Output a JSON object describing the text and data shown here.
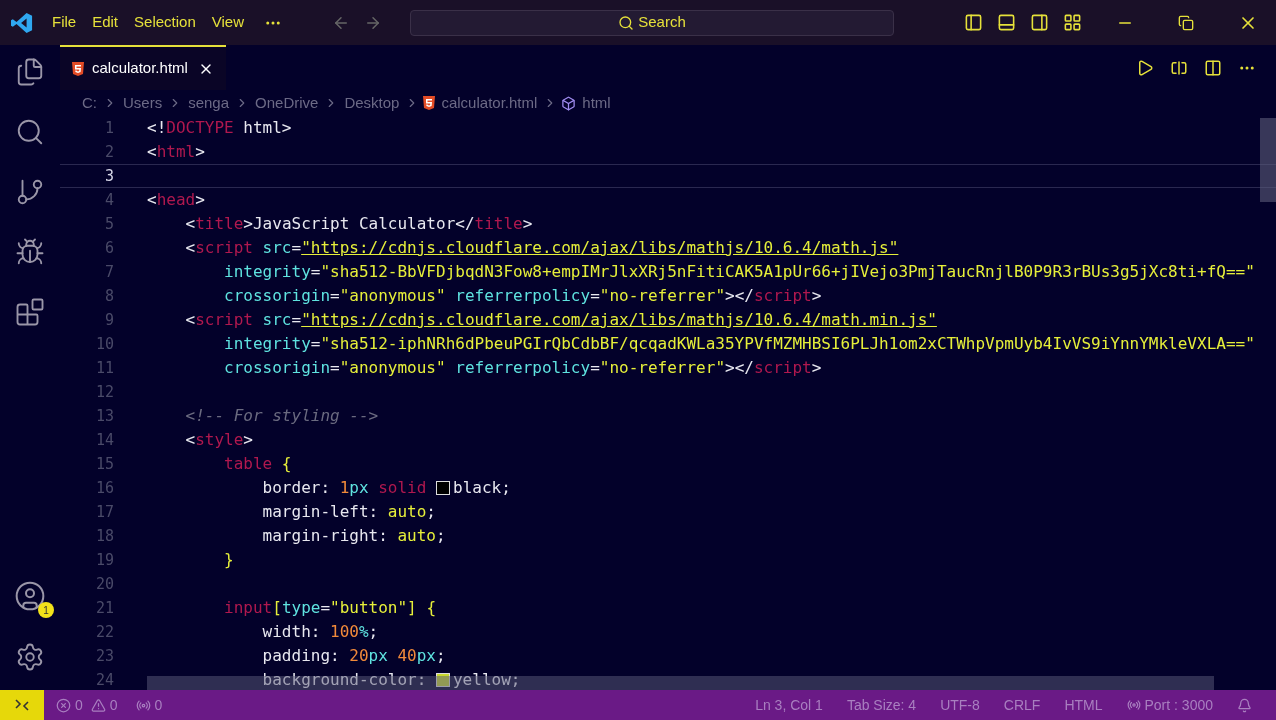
{
  "menu": [
    "File",
    "Edit",
    "Selection",
    "View"
  ],
  "search": {
    "placeholder": "Search"
  },
  "tabs": [
    {
      "label": "calculator.html",
      "selected": true
    }
  ],
  "breadcrumbs": [
    {
      "kind": "folder",
      "text": "C:"
    },
    {
      "kind": "folder",
      "text": "Users"
    },
    {
      "kind": "folder",
      "text": "senga"
    },
    {
      "kind": "folder",
      "text": "OneDrive"
    },
    {
      "kind": "folder",
      "text": "Desktop"
    },
    {
      "kind": "file",
      "text": "calculator.html"
    },
    {
      "kind": "element",
      "text": "html"
    }
  ],
  "account_badge": "1",
  "lines": [
    {
      "number": "1",
      "selected": false,
      "tokens": [
        {
          "kind": "p",
          "text": "<!"
        },
        {
          "kind": "tag",
          "text": "DOCTYPE"
        },
        {
          "kind": "p",
          "text": " html>"
        }
      ]
    },
    {
      "number": "2",
      "selected": false,
      "tokens": [
        {
          "kind": "p",
          "text": "<"
        },
        {
          "kind": "tag",
          "text": "html"
        },
        {
          "kind": "p",
          "text": ">"
        }
      ]
    },
    {
      "number": "3",
      "selected": true
    },
    {
      "number": "4",
      "selected": false,
      "tokens": [
        {
          "kind": "p",
          "text": "<"
        },
        {
          "kind": "tag",
          "text": "head"
        },
        {
          "kind": "p",
          "text": ">"
        }
      ]
    },
    {
      "number": "5",
      "selected": false,
      "tokens": [
        {
          "kind": "p",
          "text": "    <"
        },
        {
          "kind": "tag",
          "text": "title"
        },
        {
          "kind": "p",
          "text": ">JavaScript Calculator</"
        },
        {
          "kind": "tag",
          "text": "title"
        },
        {
          "kind": "p",
          "text": ">"
        }
      ]
    },
    {
      "number": "6",
      "selected": false,
      "tokens": [
        {
          "kind": "p",
          "text": "    <"
        },
        {
          "kind": "tag",
          "text": "script"
        },
        {
          "kind": "attr",
          "text": " src"
        },
        {
          "kind": "p",
          "text": "="
        },
        {
          "kind": "url",
          "text": "\"https://cdnjs.cloudflare.com/ajax/libs/mathjs/10.6.4/math.js\""
        }
      ]
    },
    {
      "number": "7",
      "selected": false,
      "tokens": [
        {
          "kind": "attr",
          "text": "        integrity"
        },
        {
          "kind": "p",
          "text": "="
        },
        {
          "kind": "str",
          "text": "\"sha512-BbVFDjbqdN3Fow8+empIMrJlxXRj5nFitiCAK5A1pUr66+jIVejo3PmjTaucRnjlB0P9R3rBUs3g5jXc8ti+fQ==\""
        }
      ]
    },
    {
      "number": "8",
      "selected": false,
      "tokens": [
        {
          "kind": "attr",
          "text": "        crossorigin"
        },
        {
          "kind": "p",
          "text": "="
        },
        {
          "kind": "str",
          "text": "\"anonymous\""
        },
        {
          "kind": "attr",
          "text": " referrerpolicy"
        },
        {
          "kind": "p",
          "text": "="
        },
        {
          "kind": "str",
          "text": "\"no-referrer\""
        },
        {
          "kind": "p",
          "text": "></"
        },
        {
          "kind": "tag",
          "text": "script"
        },
        {
          "kind": "p",
          "text": ">"
        }
      ]
    },
    {
      "number": "9",
      "selected": false,
      "tokens": [
        {
          "kind": "p",
          "text": "    <"
        },
        {
          "kind": "tag",
          "text": "script"
        },
        {
          "kind": "attr",
          "text": " src"
        },
        {
          "kind": "p",
          "text": "="
        },
        {
          "kind": "url",
          "text": "\"https://cdnjs.cloudflare.com/ajax/libs/mathjs/10.6.4/math.min.js\""
        }
      ]
    },
    {
      "number": "10",
      "selected": false,
      "tokens": [
        {
          "kind": "attr",
          "text": "        integrity"
        },
        {
          "kind": "p",
          "text": "="
        },
        {
          "kind": "str",
          "text": "\"sha512-iphNRh6dPbeuPGIrQbCdbBF/qcqadKWLa35YPVfMZMHBSI6PLJh1om2xCTWhpVpmUyb4IvVS9iYnnYMkleVXLA==\""
        }
      ]
    },
    {
      "number": "11",
      "selected": false,
      "tokens": [
        {
          "kind": "attr",
          "text": "        crossorigin"
        },
        {
          "kind": "p",
          "text": "="
        },
        {
          "kind": "str",
          "text": "\"anonymous\""
        },
        {
          "kind": "attr",
          "text": " referrerpolicy"
        },
        {
          "kind": "p",
          "text": "="
        },
        {
          "kind": "str",
          "text": "\"no-referrer\""
        },
        {
          "kind": "p",
          "text": "></"
        },
        {
          "kind": "tag",
          "text": "script"
        },
        {
          "kind": "p",
          "text": ">"
        }
      ]
    },
    {
      "number": "12",
      "selected": false
    },
    {
      "number": "13",
      "selected": false,
      "tokens": [
        {
          "kind": "cmt",
          "text": "    <!-- For styling -->"
        }
      ]
    },
    {
      "number": "14",
      "selected": false,
      "tokens": [
        {
          "kind": "p",
          "text": "    <"
        },
        {
          "kind": "tag",
          "text": "style"
        },
        {
          "kind": "p",
          "text": ">"
        }
      ]
    },
    {
      "number": "15",
      "selected": false,
      "tokens": [
        {
          "kind": "tag",
          "text": "        table"
        },
        {
          "kind": "brace",
          "text": " {"
        }
      ]
    },
    {
      "number": "16",
      "selected": false,
      "tokens": [
        {
          "kind": "p",
          "text": "            border: "
        },
        {
          "kind": "num",
          "text": "1"
        },
        {
          "kind": "unit",
          "text": "px"
        },
        {
          "kind": "tag",
          "text": " solid "
        },
        {
          "kind": "swatch",
          "color": "#000000",
          "text": "black"
        },
        {
          "kind": "p",
          "text": ";"
        }
      ]
    },
    {
      "number": "17",
      "selected": false,
      "tokens": [
        {
          "kind": "p",
          "text": "            margin-left: "
        },
        {
          "kind": "str",
          "text": "auto"
        },
        {
          "kind": "p",
          "text": ";"
        }
      ]
    },
    {
      "number": "18",
      "selected": false,
      "tokens": [
        {
          "kind": "p",
          "text": "            margin-right: "
        },
        {
          "kind": "str",
          "text": "auto"
        },
        {
          "kind": "p",
          "text": ";"
        }
      ]
    },
    {
      "number": "19",
      "selected": false,
      "tokens": [
        {
          "kind": "brace",
          "text": "        }"
        }
      ]
    },
    {
      "number": "20",
      "selected": false
    },
    {
      "number": "21",
      "selected": false,
      "tokens": [
        {
          "kind": "tag",
          "text": "        input"
        },
        {
          "kind": "brace",
          "text": "["
        },
        {
          "kind": "attr",
          "text": "type"
        },
        {
          "kind": "p",
          "text": "="
        },
        {
          "kind": "str",
          "text": "\"button\""
        },
        {
          "kind": "brace",
          "text": "] {"
        }
      ]
    },
    {
      "number": "22",
      "selected": false,
      "tokens": [
        {
          "kind": "p",
          "text": "            width: "
        },
        {
          "kind": "num",
          "text": "100"
        },
        {
          "kind": "unit",
          "text": "%"
        },
        {
          "kind": "p",
          "text": ";"
        }
      ]
    },
    {
      "number": "23",
      "selected": false,
      "tokens": [
        {
          "kind": "p",
          "text": "            padding: "
        },
        {
          "kind": "num",
          "text": "20"
        },
        {
          "kind": "unit",
          "text": "px"
        },
        {
          "kind": "num",
          "text": " 40"
        },
        {
          "kind": "unit",
          "text": "px"
        },
        {
          "kind": "p",
          "text": ";"
        }
      ]
    },
    {
      "number": "24",
      "selected": false,
      "tokens": [
        {
          "kind": "p",
          "text": "            background-color: "
        },
        {
          "kind": "swatch",
          "color": "#c8d82e",
          "text": "yellow"
        },
        {
          "kind": "p",
          "text": ";"
        }
      ]
    }
  ],
  "status_bar": {
    "errors": "0",
    "warnings": "0",
    "ports": "0",
    "right": [
      {
        "kind": "text",
        "text": "Ln 3, Col 1"
      },
      {
        "kind": "text",
        "text": "Tab Size: 4"
      },
      {
        "kind": "text",
        "text": "UTF-8"
      },
      {
        "kind": "text",
        "text": "CRLF"
      },
      {
        "kind": "text",
        "text": "HTML"
      },
      {
        "kind": "port",
        "text": "Port : 3000"
      }
    ]
  }
}
